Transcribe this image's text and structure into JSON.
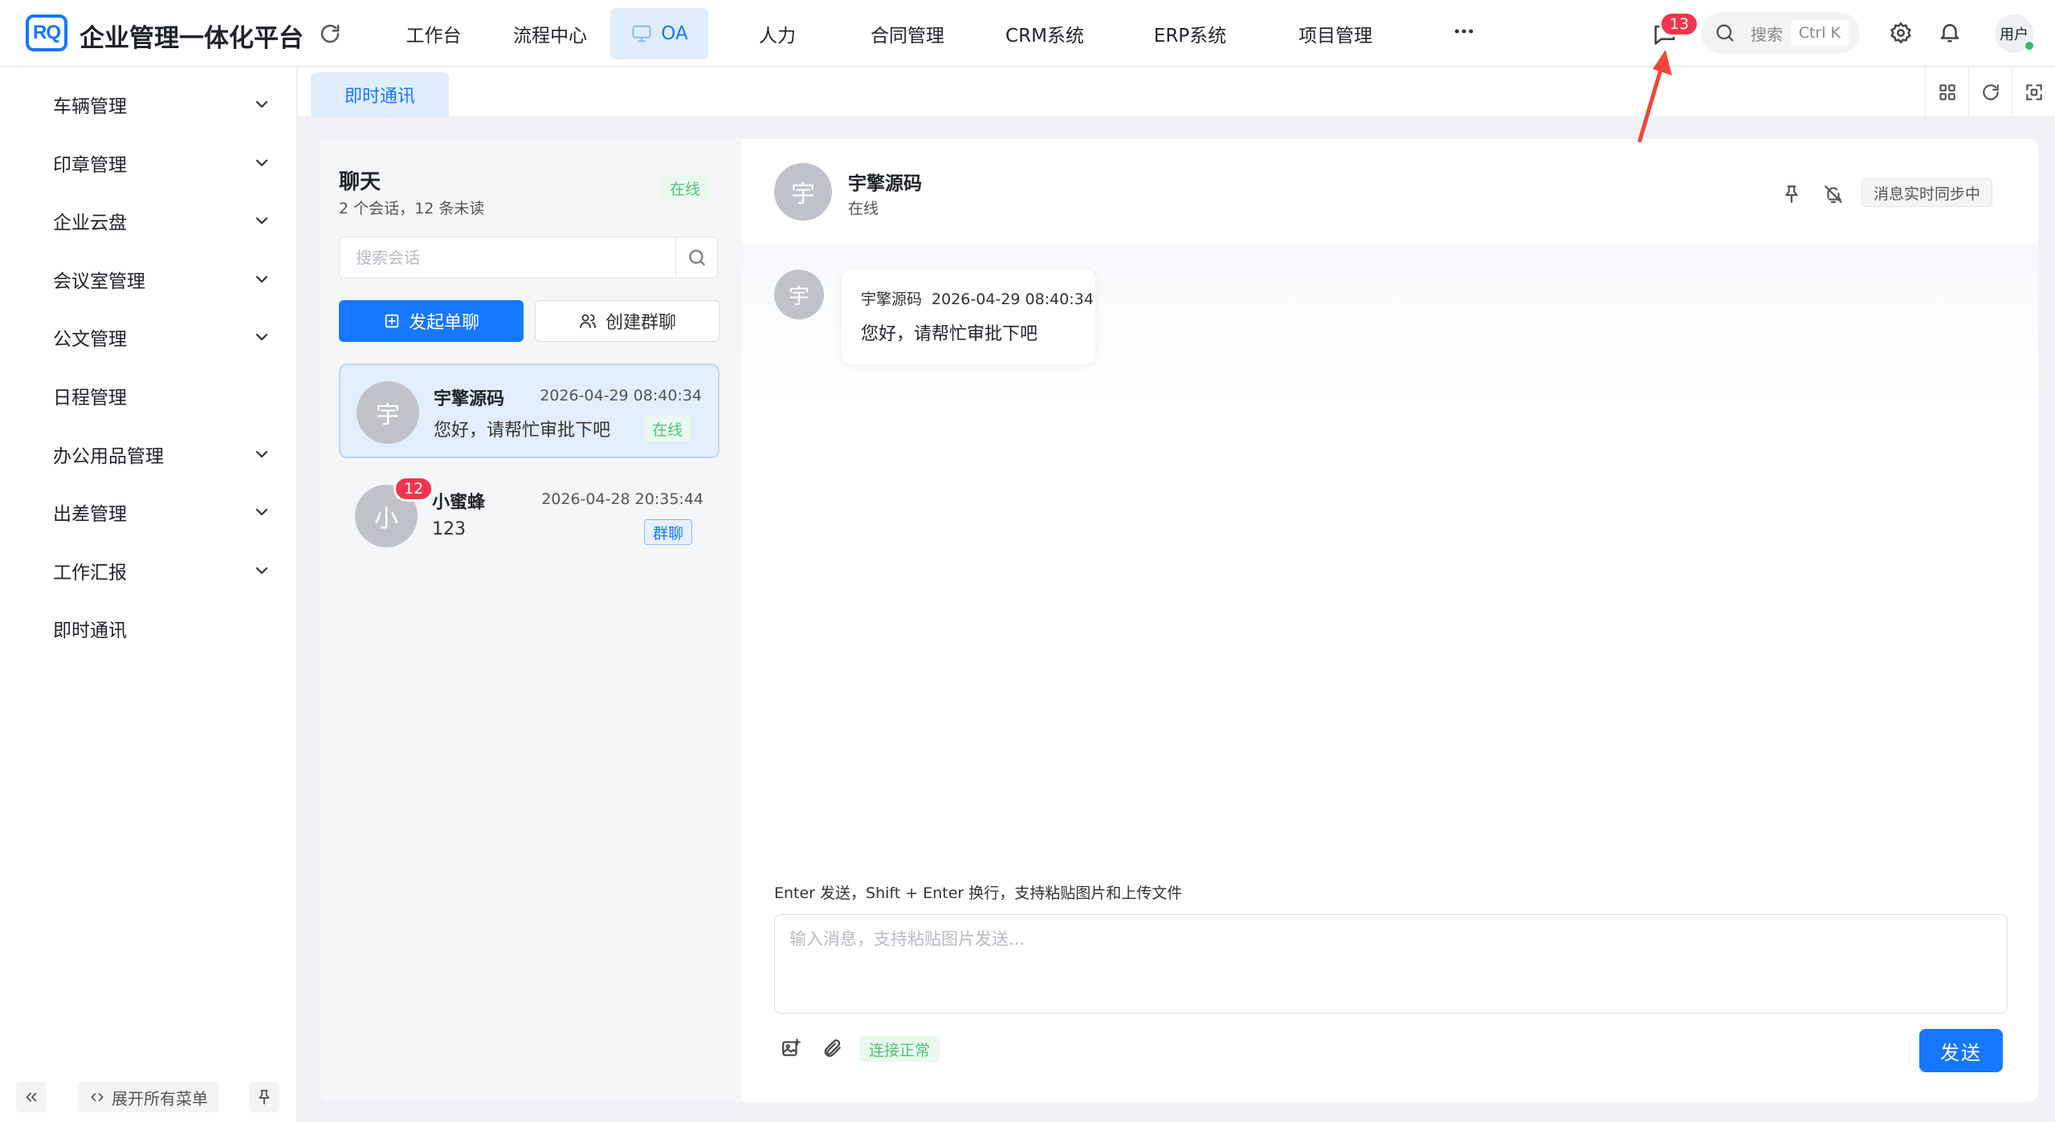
{
  "app": {
    "logo_text": "RQ",
    "title": "企业管理一体化平台"
  },
  "nav": {
    "items": [
      {
        "label": "工作台"
      },
      {
        "label": "流程中心"
      },
      {
        "label": "OA"
      },
      {
        "label": "人力"
      },
      {
        "label": "合同管理"
      },
      {
        "label": "CRM系统"
      },
      {
        "label": "ERP系统"
      },
      {
        "label": "项目管理"
      }
    ],
    "active": "OA"
  },
  "header": {
    "message_count": "13",
    "search_label": "搜索",
    "search_shortcut": "Ctrl K",
    "user_label": "用户"
  },
  "sidebar": {
    "items": [
      {
        "label": "车辆管理",
        "expandable": true
      },
      {
        "label": "印章管理",
        "expandable": true
      },
      {
        "label": "企业云盘",
        "expandable": true
      },
      {
        "label": "会议室管理",
        "expandable": true
      },
      {
        "label": "公文管理",
        "expandable": true
      },
      {
        "label": "日程管理",
        "expandable": false
      },
      {
        "label": "办公用品管理",
        "expandable": true
      },
      {
        "label": "出差管理",
        "expandable": true
      },
      {
        "label": "工作汇报",
        "expandable": true
      },
      {
        "label": "即时通讯",
        "expandable": false
      }
    ],
    "expand_all_label": "展开所有菜单"
  },
  "tabs": {
    "active_label": "即时通讯"
  },
  "conversations": {
    "title": "聊天",
    "summary": "2 个会话，12 条未读",
    "status": "在线",
    "search_placeholder": "搜索会话",
    "start_chat_label": "发起单聊",
    "create_group_label": "创建群聊",
    "items": [
      {
        "avatar": "宇",
        "name": "宇擎源码",
        "time": "2026-04-29 08:40:34",
        "last_message": "您好，请帮忙审批下吧",
        "tag": "在线",
        "unread": ""
      },
      {
        "avatar": "小",
        "name": "小蜜蜂",
        "time": "2026-04-28 20:35:44",
        "last_message": "123",
        "tag": "群聊",
        "unread": "12"
      }
    ]
  },
  "chat": {
    "avatar": "宇",
    "name": "宇擎源码",
    "status": "在线",
    "sync_label": "消息实时同步中",
    "messages": [
      {
        "avatar": "宇",
        "sender": "宇擎源码",
        "time": "2026-04-29 08:40:34",
        "text": "您好，请帮忙审批下吧"
      }
    ],
    "hint": "Enter 发送，Shift + Enter 换行，支持粘贴图片和上传文件",
    "input_placeholder": "输入消息，支持粘贴图片发送...",
    "connection_status": "连接正常",
    "send_label": "发送"
  },
  "colors": {
    "primary": "#1677ff",
    "badge": "#f5344d",
    "success": "#52c47a",
    "annotation_arrow": "#f0463c"
  }
}
